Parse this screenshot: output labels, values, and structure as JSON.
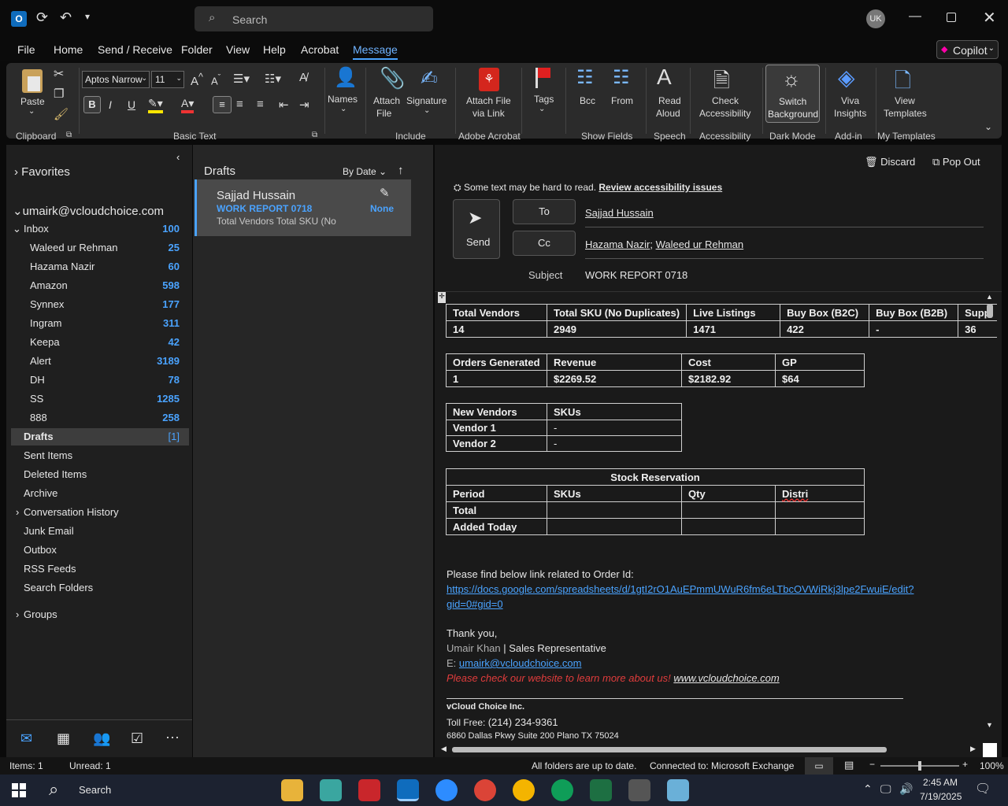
{
  "titlebar": {
    "search_placeholder": "Search",
    "avatar": "UK"
  },
  "menu": [
    "File",
    "Home",
    "Send / Receive",
    "Folder",
    "View",
    "Help",
    "Acrobat",
    "Message"
  ],
  "copilot": "Copilot",
  "ribbon": {
    "paste": "Paste",
    "font_name": "Aptos Narrow",
    "font_size": "11",
    "names": "Names",
    "attach_file": "Attach",
    "attach_file2": "File",
    "signature": "Signature",
    "attach_link1": "Attach File",
    "attach_link2": "via Link",
    "tags": "Tags",
    "bcc": "Bcc",
    "from": "From",
    "read_aloud1": "Read",
    "read_aloud2": "Aloud",
    "check_acc1": "Check",
    "check_acc2": "Accessibility",
    "switch_bg1": "Switch",
    "switch_bg2": "Background",
    "viva1": "Viva",
    "viva2": "Insights",
    "view_tpl1": "View",
    "view_tpl2": "Templates",
    "groups": {
      "clipboard": "Clipboard",
      "basic_text": "Basic Text",
      "include": "Include",
      "adobe": "Adobe Acrobat",
      "show_fields": "Show Fields",
      "speech": "Speech",
      "accessibility": "Accessibility",
      "dark_mode": "Dark Mode",
      "addin": "Add-in",
      "templates": "My Templates"
    }
  },
  "nav": {
    "favorites": "Favorites",
    "account": "umairk@vcloudchoice.com",
    "inbox": {
      "label": "Inbox",
      "count": "100"
    },
    "subfolders": [
      {
        "label": "Waleed ur Rehman",
        "count": "25"
      },
      {
        "label": "Hazama Nazir",
        "count": "60"
      },
      {
        "label": "Amazon",
        "count": "598"
      },
      {
        "label": "Synnex",
        "count": "177"
      },
      {
        "label": "Ingram",
        "count": "311"
      },
      {
        "label": "Keepa",
        "count": "42"
      },
      {
        "label": "Alert",
        "count": "3189"
      },
      {
        "label": "DH",
        "count": "78"
      },
      {
        "label": "SS",
        "count": "1285"
      },
      {
        "label": "888",
        "count": "258"
      }
    ],
    "drafts": {
      "label": "Drafts",
      "count": "[1]"
    },
    "folders": [
      "Sent Items",
      "Deleted Items",
      "Archive",
      "Conversation History",
      "Junk Email",
      "Outbox",
      "RSS Feeds",
      "Search Folders"
    ],
    "groups": "Groups"
  },
  "list": {
    "title": "Drafts",
    "sort": "By Date",
    "item": {
      "from": "Sajjad Hussain",
      "subject": "WORK REPORT 0718",
      "preview": "Total Vendors  Total SKU (No",
      "status": "None"
    }
  },
  "compose": {
    "discard": "Discard",
    "popout": "Pop Out",
    "hint": "Some text may be hard to read.",
    "hint_link": "Review accessibility issues",
    "send": "Send",
    "to_btn": "To",
    "cc_btn": "Cc",
    "to": "Sajjad Hussain",
    "cc1": "Hazama Nazir",
    "cc_sep": ";",
    "cc2": "Waleed ur Rehman",
    "subject_label": "Subject",
    "subject": "WORK REPORT 0718"
  },
  "t1": {
    "h": [
      "Total Vendors",
      "Total SKU (No Duplicates)",
      "Live Listings",
      "Buy Box (B2C)",
      "Buy Box (B2B)",
      "Supp"
    ],
    "v": [
      "14",
      "2949",
      "1471",
      "422",
      "-",
      "36"
    ]
  },
  "t2": {
    "h": [
      "Orders Generated",
      "Revenue",
      "Cost",
      "GP"
    ],
    "v": [
      "1",
      "$2269.52",
      "$2182.92",
      "$64"
    ]
  },
  "t3": {
    "h": [
      "New Vendors",
      "SKUs"
    ],
    "r1": [
      "Vendor 1",
      "-"
    ],
    "r2": [
      "Vendor 2",
      "-"
    ]
  },
  "t4": {
    "title": "Stock Reservation",
    "h": [
      "Period",
      "SKUs",
      "Qty",
      "Distri"
    ],
    "r1": "Total",
    "r2": "Added Today"
  },
  "body": {
    "intro": "Please find below link related to Order Id:",
    "url1": "https://docs.google.com/spreadsheets/d/1gtI2rO1AuEPmmUWuR6fm6eLTbcOVWiRkj3lpe2FwuiE/edit?",
    "url2": "gid=0#gid=0",
    "thanks": "Thank you,",
    "sig_name": "Umair Khan",
    "sig_sep": " | ",
    "sig_title": "Sales Representative",
    "email_label": "E: ",
    "email": "umairk@vcloudchoice.com",
    "promo": "Please check our website to learn more about us! ",
    "site": "www.vcloudchoice.com",
    "company": "vCloud Choice Inc.",
    "tollfree_label": "Toll Free: ",
    "tollfree": "(214) 234-9361",
    "address": "6860 Dallas Pkwy Suite 200 Plano TX 75024"
  },
  "status": {
    "items": "Items: 1",
    "unread": "Unread: 1",
    "sync": "All folders are up to date.",
    "conn": "Connected to: Microsoft Exchange",
    "zoom": "100%"
  },
  "taskbar": {
    "search": "Search",
    "time": "2:45 AM",
    "date": "7/19/2025"
  },
  "colors": {
    "accent": "#4aa3ff",
    "promo": "#e03c3c",
    "sig": "#b0b0b0"
  }
}
